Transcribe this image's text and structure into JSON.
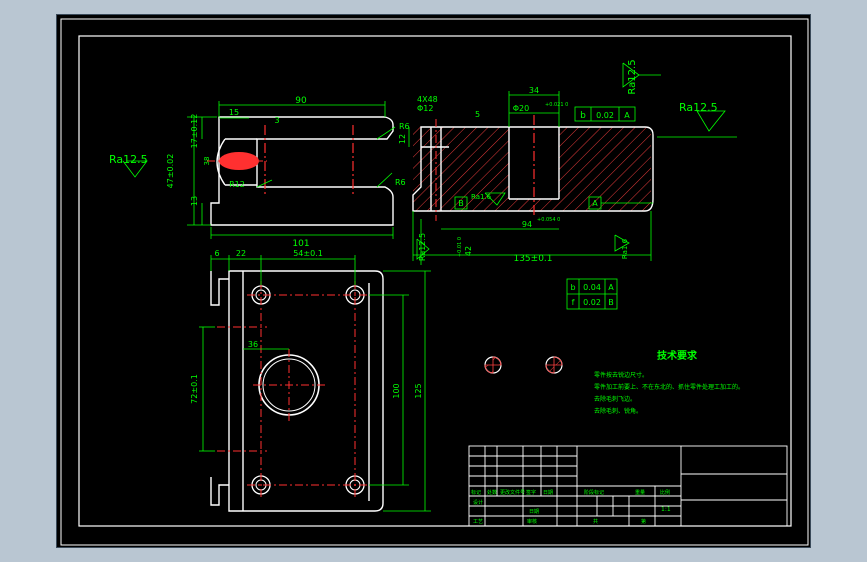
{
  "colors": {
    "background": "#000000",
    "frame": "#ffffff",
    "dimension": "#00ff00",
    "centerline": "#ff2020",
    "part": "#ffffff",
    "hatch": "#ff4040",
    "datum": "#00ff00"
  },
  "top_left_view": {
    "dims": {
      "overall_length": "90",
      "left_offset": "15",
      "small": "3",
      "height_top": "17±0.12",
      "height_total": "47±0.02",
      "height_base": "13",
      "length_bottom": "101",
      "radius_slot": "R12",
      "chamfer_r6_top": "R6",
      "chamfer_r6_bottom": "R6",
      "slot_width": "38"
    },
    "roughness": "Ra12.5"
  },
  "section_view": {
    "dims": {
      "hole_spec": "4X48",
      "hole_dia": "Φ12",
      "dim_five": "5",
      "bore": "Φ20",
      "bore_tol": "+0.021 0",
      "width_34": "34",
      "left_12": "12",
      "base_height": "42",
      "base_tol": "+0.01 0",
      "len_94": "94",
      "len_94_tol": "+0.054 0",
      "overall": "135±0.1",
      "ra_small": "Ra1.6",
      "ra_bottom": "Ra1.6"
    },
    "roughness_top": "Ra12.5",
    "roughness_right": "Ra12.5",
    "roughness_left": "Ra12.5",
    "datum_a": "A",
    "datum_b": "B",
    "gdt_top": [
      "b",
      "0.02",
      "A"
    ],
    "gdt_bottom_rows": [
      [
        "b",
        "0.04",
        "A"
      ],
      [
        "f",
        "0.02",
        "B"
      ]
    ]
  },
  "plan_view": {
    "dims": {
      "d6": "6",
      "d22": "22",
      "d54": "54±0.1",
      "d36": "36",
      "d72": "72±0.1",
      "d100": "100",
      "d125": "125"
    }
  },
  "tech_requirements": {
    "title": "技术要求",
    "items": [
      "零件按去锐边尺寸。",
      "零件加工前要上、不在东北的、抓住零件处理工加工的。",
      "去除毛刺飞边。",
      "去除毛刺、锐角。"
    ]
  },
  "title_block": {
    "labels": [
      "标记",
      "处数",
      "更改文件号",
      "签字",
      "日期"
    ],
    "row_design": "设计",
    "row_process": "工艺",
    "row_check": "审核",
    "stage_label": "阶段标记",
    "weight_label": "重量",
    "scale_label": "比例",
    "scale_value": "1:1",
    "sheet_label": "共",
    "sheet_of": "第",
    "date_label": "日期"
  }
}
